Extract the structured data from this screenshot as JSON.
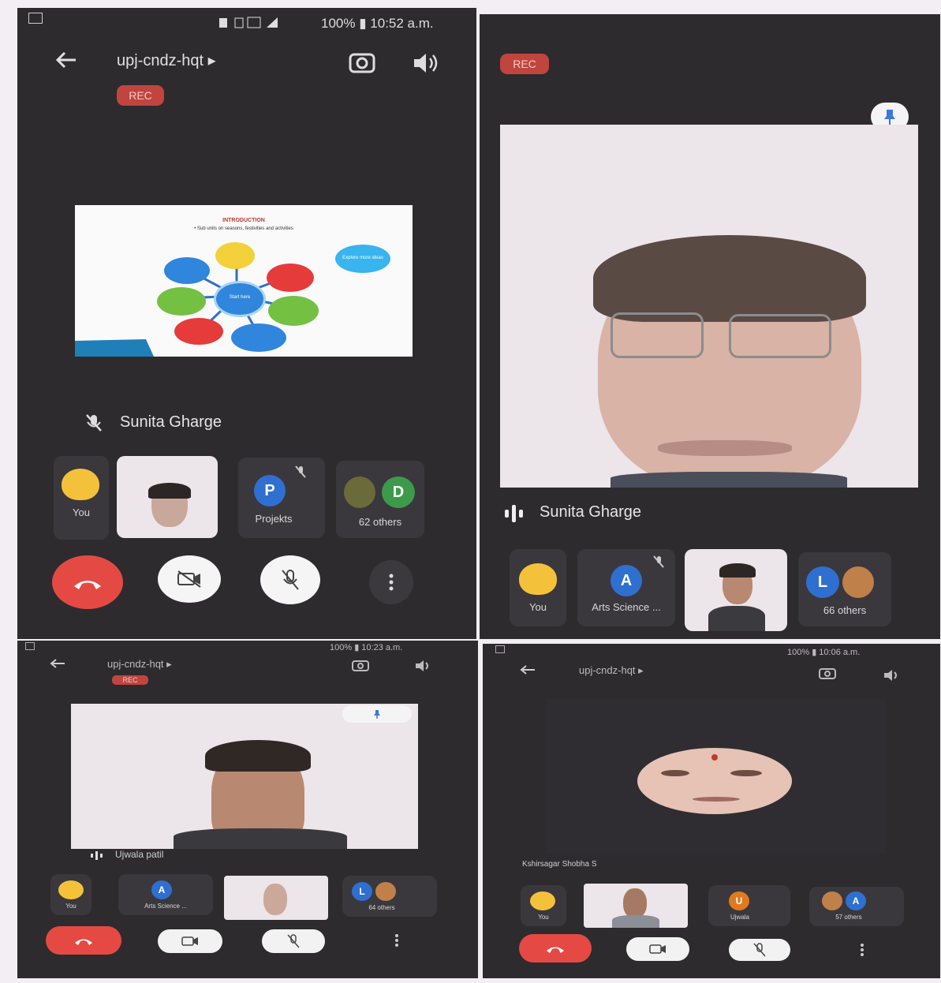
{
  "colors": {
    "panel_bg": "#2d2b2e",
    "rec_red": "#c0453f",
    "end_call_red": "#e44a43",
    "avatar_blue": "#2f6fd0",
    "avatar_green": "#3d9a4a",
    "avatar_orange": "#e07a1f"
  },
  "panel1": {
    "status": "100% ▮ 10:52 a.m.",
    "meeting_code": "upj-cndz-hqt ▸",
    "rec": "REC",
    "slide": {
      "title": "INTRODUCTION",
      "subtitle": "• Sub units on seasons, festivities and activities",
      "center": "Start here",
      "side_note": "Explore more ideas"
    },
    "presenter": "Sunita Gharge",
    "tiles": {
      "you": "You",
      "p_letter": "P",
      "p_name": "Projekts",
      "d_letter": "D",
      "others": "62 others"
    }
  },
  "panel2": {
    "rec": "REC",
    "speaker": "Sunita Gharge",
    "tiles": {
      "you": "You",
      "a_letter": "A",
      "a_name": "Arts Science ...",
      "l_letter": "L",
      "others": "66 others"
    }
  },
  "panel3": {
    "status": "100% ▮ 10:23 a.m.",
    "meeting_code": "upj-cndz-hqt ▸",
    "rec": "REC",
    "speaker": "Ujwala patil",
    "tiles": {
      "you": "You",
      "a_letter": "A",
      "a_name": "Arts Science ...",
      "l_letter": "L",
      "others": "64 others"
    }
  },
  "panel4": {
    "status": "100% ▮ 10:06 a.m.",
    "meeting_code": "upj-cndz-hqt ▸",
    "speaker": "Kshirsagar Shobha S",
    "tiles": {
      "you": "You",
      "u_letter": "U",
      "u_name": "Ujwala",
      "a_letter": "A",
      "others": "57 others"
    }
  }
}
